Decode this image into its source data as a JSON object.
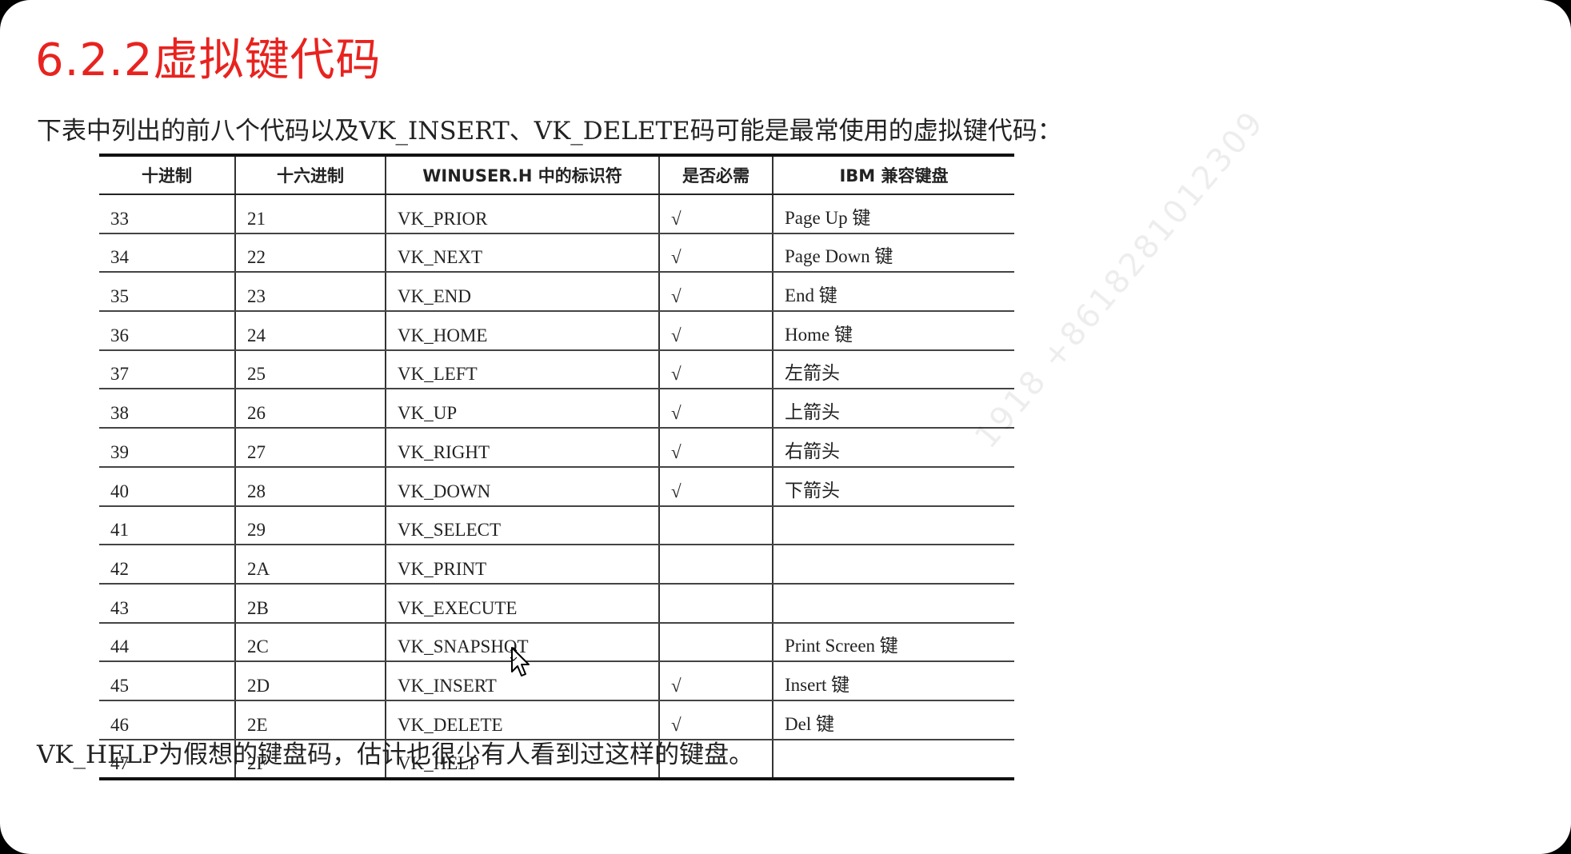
{
  "title": "6.2.2虚拟键代码",
  "intro": "下表中列出的前八个代码以及VK_INSERT、VK_DELETE码可能是最常使用的虚拟键代码：",
  "table": {
    "headers": [
      "十进制",
      "十六进制",
      "WINUSER.H 中的标识符",
      "是否必需",
      "IBM 兼容键盘"
    ],
    "rows": [
      {
        "dec": "33",
        "hex": "21",
        "id": "VK_PRIOR",
        "req": "√",
        "ibm": "Page Up 键"
      },
      {
        "dec": "34",
        "hex": "22",
        "id": "VK_NEXT",
        "req": "√",
        "ibm": "Page Down 键"
      },
      {
        "dec": "35",
        "hex": "23",
        "id": "VK_END",
        "req": "√",
        "ibm": "End 键"
      },
      {
        "dec": "36",
        "hex": "24",
        "id": "VK_HOME",
        "req": "√",
        "ibm": "Home 键"
      },
      {
        "dec": "37",
        "hex": "25",
        "id": "VK_LEFT",
        "req": "√",
        "ibm": "左箭头"
      },
      {
        "dec": "38",
        "hex": "26",
        "id": "VK_UP",
        "req": "√",
        "ibm": "上箭头"
      },
      {
        "dec": "39",
        "hex": "27",
        "id": "VK_RIGHT",
        "req": "√",
        "ibm": "右箭头"
      },
      {
        "dec": "40",
        "hex": "28",
        "id": "VK_DOWN",
        "req": "√",
        "ibm": "下箭头"
      },
      {
        "dec": "41",
        "hex": "29",
        "id": "VK_SELECT",
        "req": "",
        "ibm": ""
      },
      {
        "dec": "42",
        "hex": "2A",
        "id": "VK_PRINT",
        "req": "",
        "ibm": ""
      },
      {
        "dec": "43",
        "hex": "2B",
        "id": "VK_EXECUTE",
        "req": "",
        "ibm": ""
      },
      {
        "dec": "44",
        "hex": "2C",
        "id": "VK_SNAPSHOT",
        "req": "",
        "ibm": "Print Screen 键"
      },
      {
        "dec": "45",
        "hex": "2D",
        "id": "VK_INSERT",
        "req": "√",
        "ibm": "Insert 键"
      },
      {
        "dec": "46",
        "hex": "2E",
        "id": "VK_DELETE",
        "req": "√",
        "ibm": "Del 键"
      },
      {
        "dec": "47",
        "hex": "2F",
        "id": "VK_HELP",
        "req": "",
        "ibm": ""
      }
    ]
  },
  "footer": "VK_HELP为假想的键盘码，估计也很少有人看到过这样的键盘。",
  "watermark": "1918 +8618281012309",
  "colors": {
    "title": "#e8231f",
    "background": "#ffffff"
  },
  "icons": {
    "cursor": "move-cursor-icon"
  }
}
